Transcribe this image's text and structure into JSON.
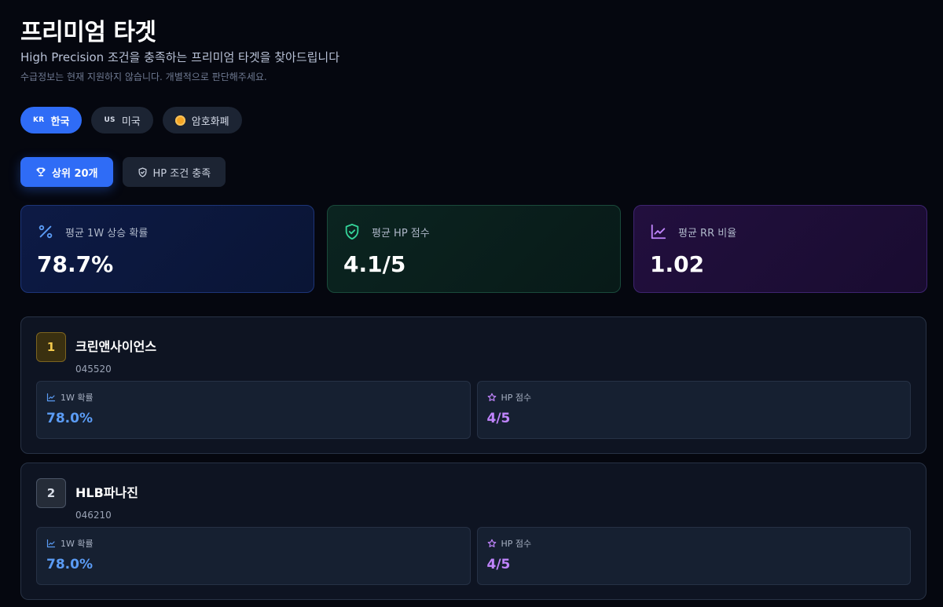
{
  "header": {
    "title": "프리미엄 타겟",
    "subtitle": "High Precision 조건을 충족하는 프리미엄 타겟을 찾아드립니다",
    "note": "수급정보는 현재 지원하지 않습니다. 개별적으로 판단해주세요."
  },
  "markets": [
    {
      "code": "KR",
      "label": "한국",
      "active": true
    },
    {
      "code": "US",
      "label": "미국",
      "active": false
    },
    {
      "icon": "coin-icon",
      "label": "암호화폐",
      "active": false
    }
  ],
  "tabs": [
    {
      "label": "상위 20개",
      "icon": "trophy-icon",
      "active": true
    },
    {
      "label": "HP 조건 충족",
      "icon": "shield-icon",
      "active": false
    }
  ],
  "stats": [
    {
      "label": "평균 1W 상승 확률",
      "value": "78.7%",
      "icon": "percent-icon",
      "color": "#5b9cf5"
    },
    {
      "label": "평균 HP 점수",
      "value": "4.1/5",
      "icon": "shield-check-icon",
      "color": "#34d399"
    },
    {
      "label": "평균 RR 비율",
      "value": "1.02",
      "icon": "trend-chart-icon",
      "color": "#c084fc"
    }
  ],
  "targets": [
    {
      "rank": "1",
      "name": "크린앤사이언스",
      "code": "045520",
      "prob_label": "1W 확률",
      "prob_value": "78.0%",
      "hp_label": "HP 점수",
      "hp_value": "4/5"
    },
    {
      "rank": "2",
      "name": "HLB파나진",
      "code": "046210",
      "prob_label": "1W 확률",
      "prob_value": "78.0%",
      "hp_label": "HP 점수",
      "hp_value": "4/5"
    }
  ]
}
